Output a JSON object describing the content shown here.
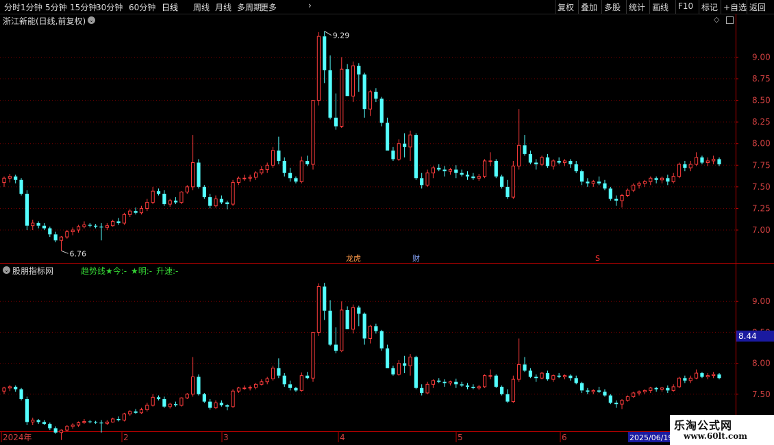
{
  "toolbar": {
    "periods": [
      "分时",
      "1分钟",
      "5分钟",
      "15分钟",
      "30分钟",
      "60分钟",
      "日线",
      "周线",
      "月线",
      "多周期",
      "更多"
    ],
    "active_period": "日线",
    "tools": [
      "复权",
      "叠加",
      "多股",
      "统计",
      "画线",
      "F10",
      "标记",
      "+自选",
      "返回"
    ]
  },
  "main_title": "浙江新能(日线,前复权)",
  "lower_title": "股朋指标网",
  "indicator": {
    "trend": "趋势线★今:-",
    "ming": "★明:-",
    "speed": "升速:-"
  },
  "current_price_label": "8.44",
  "markers": {
    "top": "龙虎",
    "cai": "财",
    "s": "S"
  },
  "date_labels": [
    "2024年",
    "2",
    "3",
    "4",
    "5",
    "6"
  ],
  "cursor_date": "2025/06/19",
  "watermark": {
    "title": "乐淘公式网",
    "url": "www.60lt.com"
  },
  "chart_data": {
    "type": "candlestick",
    "upper_y_ticks": [
      9.0,
      8.75,
      8.5,
      8.25,
      8.0,
      7.75,
      7.5,
      7.25,
      7.0
    ],
    "upper_ylim": [
      6.62,
      9.36
    ],
    "lower_y_ticks": [
      9.0,
      8.5,
      8.0,
      7.5
    ],
    "lower_ylim": [
      6.9,
      9.6
    ],
    "annotations": [
      {
        "text": "9.29",
        "type": "max"
      },
      {
        "text": "6.76",
        "type": "min"
      }
    ],
    "colors": {
      "up": "#ff3c3c",
      "down": "#54ffff",
      "grid": "#7a0000",
      "axis": "#c00000"
    },
    "ohlc": [
      [
        7.55,
        7.62,
        7.5,
        7.6
      ],
      [
        7.6,
        7.65,
        7.55,
        7.62
      ],
      [
        7.62,
        7.64,
        7.54,
        7.58
      ],
      [
        7.58,
        7.6,
        7.4,
        7.42
      ],
      [
        7.42,
        7.46,
        7.0,
        7.05
      ],
      [
        7.05,
        7.12,
        7.0,
        7.08
      ],
      [
        7.08,
        7.1,
        7.02,
        7.05
      ],
      [
        7.05,
        7.08,
        7.0,
        7.02
      ],
      [
        7.02,
        7.04,
        6.92,
        6.95
      ],
      [
        6.95,
        6.98,
        6.86,
        6.88
      ],
      [
        6.88,
        6.93,
        6.76,
        6.92
      ],
      [
        6.92,
        7.0,
        6.9,
        6.98
      ],
      [
        6.98,
        7.03,
        6.94,
        7.0
      ],
      [
        7.0,
        7.06,
        6.97,
        7.04
      ],
      [
        7.04,
        7.1,
        7.02,
        7.06
      ],
      [
        7.06,
        7.08,
        7.03,
        7.05
      ],
      [
        7.05,
        7.07,
        7.02,
        7.04
      ],
      [
        7.04,
        7.08,
        6.88,
        7.03
      ],
      [
        7.03,
        7.08,
        7.0,
        7.05
      ],
      [
        7.05,
        7.12,
        7.04,
        7.1
      ],
      [
        7.1,
        7.14,
        7.06,
        7.08
      ],
      [
        7.08,
        7.2,
        7.06,
        7.18
      ],
      [
        7.18,
        7.24,
        7.15,
        7.22
      ],
      [
        7.22,
        7.26,
        7.18,
        7.2
      ],
      [
        7.2,
        7.28,
        7.18,
        7.25
      ],
      [
        7.25,
        7.36,
        7.22,
        7.32
      ],
      [
        7.32,
        7.5,
        7.3,
        7.45
      ],
      [
        7.45,
        7.48,
        7.4,
        7.42
      ],
      [
        7.42,
        7.46,
        7.28,
        7.3
      ],
      [
        7.3,
        7.36,
        7.27,
        7.34
      ],
      [
        7.34,
        7.38,
        7.3,
        7.32
      ],
      [
        7.32,
        7.45,
        7.3,
        7.44
      ],
      [
        7.44,
        7.52,
        7.42,
        7.5
      ],
      [
        7.5,
        8.1,
        7.46,
        7.78
      ],
      [
        7.78,
        7.82,
        7.48,
        7.5
      ],
      [
        7.5,
        7.52,
        7.36,
        7.38
      ],
      [
        7.38,
        7.42,
        7.25,
        7.28
      ],
      [
        7.28,
        7.4,
        7.26,
        7.36
      ],
      [
        7.36,
        7.4,
        7.3,
        7.32
      ],
      [
        7.32,
        7.34,
        7.24,
        7.3
      ],
      [
        7.3,
        7.58,
        7.28,
        7.55
      ],
      [
        7.55,
        7.62,
        7.52,
        7.6
      ],
      [
        7.6,
        7.64,
        7.57,
        7.6
      ],
      [
        7.6,
        7.64,
        7.56,
        7.61
      ],
      [
        7.61,
        7.68,
        7.58,
        7.66
      ],
      [
        7.66,
        7.74,
        7.64,
        7.7
      ],
      [
        7.7,
        7.78,
        7.66,
        7.75
      ],
      [
        7.75,
        7.96,
        7.72,
        7.92
      ],
      [
        7.92,
        8.08,
        7.76,
        7.8
      ],
      [
        7.8,
        7.84,
        7.62,
        7.66
      ],
      [
        7.66,
        7.72,
        7.56,
        7.6
      ],
      [
        7.6,
        7.62,
        7.54,
        7.56
      ],
      [
        7.56,
        7.85,
        7.54,
        7.8
      ],
      [
        7.8,
        7.86,
        7.74,
        7.76
      ],
      [
        7.76,
        8.5,
        7.7,
        8.5
      ],
      [
        8.5,
        9.29,
        8.44,
        9.24
      ],
      [
        9.24,
        9.3,
        8.7,
        8.85
      ],
      [
        8.85,
        9.02,
        8.28,
        8.3
      ],
      [
        8.3,
        8.58,
        8.16,
        8.2
      ],
      [
        8.2,
        9.0,
        8.18,
        8.86
      ],
      [
        8.86,
        8.92,
        8.55,
        8.55
      ],
      [
        8.55,
        8.95,
        8.48,
        8.9
      ],
      [
        8.9,
        8.93,
        8.6,
        8.8
      ],
      [
        8.8,
        8.82,
        8.3,
        8.4
      ],
      [
        8.4,
        8.62,
        8.32,
        8.6
      ],
      [
        8.6,
        8.64,
        8.48,
        8.52
      ],
      [
        8.52,
        8.54,
        8.2,
        8.24
      ],
      [
        8.24,
        8.3,
        7.92,
        7.92
      ],
      [
        7.92,
        7.96,
        7.8,
        7.82
      ],
      [
        7.82,
        8.05,
        7.8,
        8.0
      ],
      [
        8.0,
        8.12,
        7.84,
        7.96
      ],
      [
        7.96,
        8.15,
        7.8,
        8.1
      ],
      [
        8.1,
        8.12,
        7.58,
        7.6
      ],
      [
        7.6,
        7.66,
        7.48,
        7.52
      ],
      [
        7.52,
        7.7,
        7.5,
        7.66
      ],
      [
        7.66,
        7.74,
        7.6,
        7.72
      ],
      [
        7.72,
        7.76,
        7.68,
        7.7
      ],
      [
        7.7,
        7.74,
        7.62,
        7.68
      ],
      [
        7.68,
        7.72,
        7.64,
        7.7
      ],
      [
        7.7,
        7.75,
        7.6,
        7.66
      ],
      [
        7.66,
        7.7,
        7.62,
        7.64
      ],
      [
        7.64,
        7.68,
        7.58,
        7.62
      ],
      [
        7.62,
        7.66,
        7.58,
        7.6
      ],
      [
        7.6,
        7.65,
        7.57,
        7.62
      ],
      [
        7.62,
        7.82,
        7.6,
        7.8
      ],
      [
        7.8,
        7.9,
        7.74,
        7.8
      ],
      [
        7.8,
        7.82,
        7.6,
        7.62
      ],
      [
        7.62,
        7.64,
        7.48,
        7.5
      ],
      [
        7.5,
        7.58,
        7.36,
        7.38
      ],
      [
        7.38,
        7.8,
        7.36,
        7.74
      ],
      [
        7.74,
        8.4,
        7.7,
        7.98
      ],
      [
        7.98,
        8.1,
        7.86,
        7.88
      ],
      [
        7.88,
        7.92,
        7.76,
        7.78
      ],
      [
        7.78,
        7.82,
        7.7,
        7.76
      ],
      [
        7.76,
        7.86,
        7.74,
        7.84
      ],
      [
        7.84,
        7.88,
        7.72,
        7.74
      ],
      [
        7.74,
        7.82,
        7.7,
        7.8
      ],
      [
        7.8,
        7.84,
        7.76,
        7.78
      ],
      [
        7.78,
        7.82,
        7.74,
        7.8
      ],
      [
        7.8,
        7.82,
        7.72,
        7.76
      ],
      [
        7.76,
        7.8,
        7.66,
        7.68
      ],
      [
        7.68,
        7.7,
        7.52,
        7.56
      ],
      [
        7.56,
        7.6,
        7.5,
        7.54
      ],
      [
        7.54,
        7.58,
        7.5,
        7.56
      ],
      [
        7.56,
        7.62,
        7.52,
        7.54
      ],
      [
        7.54,
        7.58,
        7.46,
        7.48
      ],
      [
        7.48,
        7.5,
        7.34,
        7.36
      ],
      [
        7.36,
        7.4,
        7.28,
        7.34
      ],
      [
        7.34,
        7.42,
        7.26,
        7.4
      ],
      [
        7.4,
        7.48,
        7.38,
        7.46
      ],
      [
        7.46,
        7.54,
        7.44,
        7.52
      ],
      [
        7.52,
        7.56,
        7.48,
        7.54
      ],
      [
        7.54,
        7.58,
        7.5,
        7.56
      ],
      [
        7.56,
        7.62,
        7.52,
        7.6
      ],
      [
        7.6,
        7.62,
        7.54,
        7.58
      ],
      [
        7.58,
        7.62,
        7.54,
        7.6
      ],
      [
        7.6,
        7.64,
        7.52,
        7.56
      ],
      [
        7.56,
        7.66,
        7.54,
        7.62
      ],
      [
        7.62,
        7.78,
        7.6,
        7.76
      ],
      [
        7.76,
        7.8,
        7.68,
        7.72
      ],
      [
        7.72,
        7.8,
        7.68,
        7.76
      ],
      [
        7.76,
        7.9,
        7.74,
        7.84
      ],
      [
        7.84,
        7.86,
        7.76,
        7.78
      ],
      [
        7.78,
        7.84,
        7.74,
        7.8
      ],
      [
        7.8,
        7.86,
        7.76,
        7.82
      ],
      [
        7.82,
        7.84,
        7.74,
        7.76
      ]
    ]
  }
}
